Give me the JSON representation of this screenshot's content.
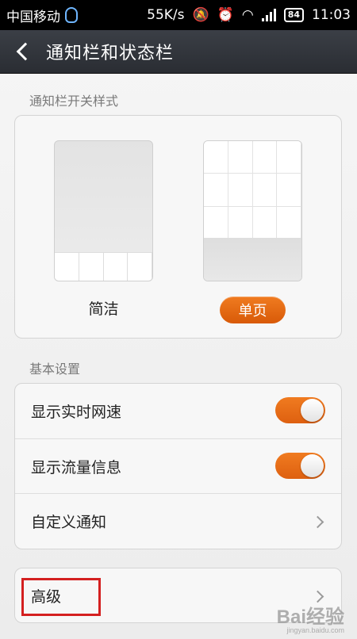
{
  "status_bar": {
    "carrier": "中国移动",
    "speed": "55K/s",
    "battery": "84",
    "time": "11:03"
  },
  "header": {
    "title": "通知栏和状态栏"
  },
  "notification_style": {
    "section_title": "通知栏开关样式",
    "options": [
      {
        "label": "简洁",
        "selected": false
      },
      {
        "label": "单页",
        "selected": true
      }
    ]
  },
  "basic_settings": {
    "section_title": "基本设置",
    "rows": [
      {
        "label": "显示实时网速",
        "control": "toggle",
        "on": true
      },
      {
        "label": "显示流量信息",
        "control": "toggle",
        "on": true
      },
      {
        "label": "自定义通知",
        "control": "chevron"
      }
    ]
  },
  "advanced": {
    "label": "高级"
  },
  "watermark": {
    "brand": "Bai经验",
    "url": "jingyan.baidu.com"
  },
  "colors": {
    "accent": "#e8690f",
    "title_bar": "#33363c",
    "highlight_box": "#d42020"
  }
}
